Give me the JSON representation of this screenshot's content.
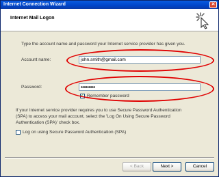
{
  "window": {
    "title": "Internet Connection Wizard",
    "close_glyph": "✕"
  },
  "header": {
    "title": "Internet Mail Logon",
    "icon": "wizard-pointer-icon"
  },
  "intro": "Type the account name and password your Internet service provider has given you.",
  "account": {
    "label": "Account name:",
    "value": "john.smith@gmail.com"
  },
  "password": {
    "label": "Password:",
    "value": "•••••••••"
  },
  "remember": {
    "label": "Remember password",
    "checked": true,
    "glyph": "✓"
  },
  "spa_text": [
    "If your Internet service provider requires you to use Secure Password Authentication",
    "(SPA) to access your mail account, select the 'Log On Using Secure Password",
    "Authentication (SPA)' check box."
  ],
  "spa_checkbox": {
    "label": "Log on using Secure Password Authentication (SPA)",
    "checked": false
  },
  "buttons": {
    "back": "< Back",
    "next": "Next >",
    "cancel": "Cancel"
  },
  "colors": {
    "highlight": "#e00000",
    "titlebar": "#0a5be0"
  }
}
